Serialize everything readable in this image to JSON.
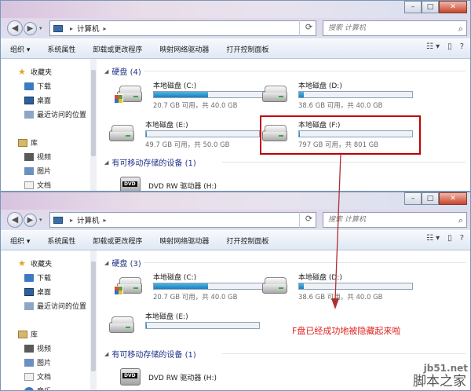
{
  "explorer": {
    "search_placeholder": "搜索 计算机",
    "address": "计算机",
    "toolbar": [
      "组织 ▾",
      "系统属性",
      "卸载或更改程序",
      "映射网络驱动器",
      "打开控制面板"
    ],
    "sidebar": {
      "favorites": "收藏夹",
      "downloads": "下载",
      "desktop": "桌面",
      "recent": "最近访问的位置",
      "libraries": "库",
      "videos": "视频",
      "pictures": "图片",
      "documents": "文档",
      "music": "音乐"
    },
    "removable_group": "有可移动存储的设备 (1)",
    "dvd_label": "DVD RW 驱动器 (H:)",
    "dvd_badge": "DVD"
  },
  "before": {
    "hdd_group": "硬盘 (4)",
    "drives": [
      {
        "name": "本地磁盘 (C:)",
        "info": "20.7 GB 可用，共 40.0 GB",
        "used": 0.48
      },
      {
        "name": "本地磁盘 (D:)",
        "info": "38.6 GB 可用，共 40.0 GB",
        "used": 0.04
      },
      {
        "name": "本地磁盘 (E:)",
        "info": "49.7 GB 可用，共 50.0 GB",
        "used": 0.01
      },
      {
        "name": "本地磁盘 (F:)",
        "info": "797 GB 可用，共 801 GB",
        "used": 0.01
      }
    ]
  },
  "after": {
    "hdd_group": "硬盘 (3)",
    "drives": [
      {
        "name": "本地磁盘 (C:)",
        "info": "20.7 GB 可用，共 40.0 GB",
        "used": 0.48
      },
      {
        "name": "本地磁盘 (D:)",
        "info": "38.6 GB 可用，共 40.0 GB",
        "used": 0.04
      },
      {
        "name": "本地磁盘 (E:)",
        "info": "",
        "used": 0.01
      }
    ]
  },
  "annotation": {
    "note": "F盘已经成功地被隐藏起来啦",
    "color": "#c00000"
  },
  "watermark": {
    "site": "jb51.net",
    "brand": "脚本之家"
  }
}
